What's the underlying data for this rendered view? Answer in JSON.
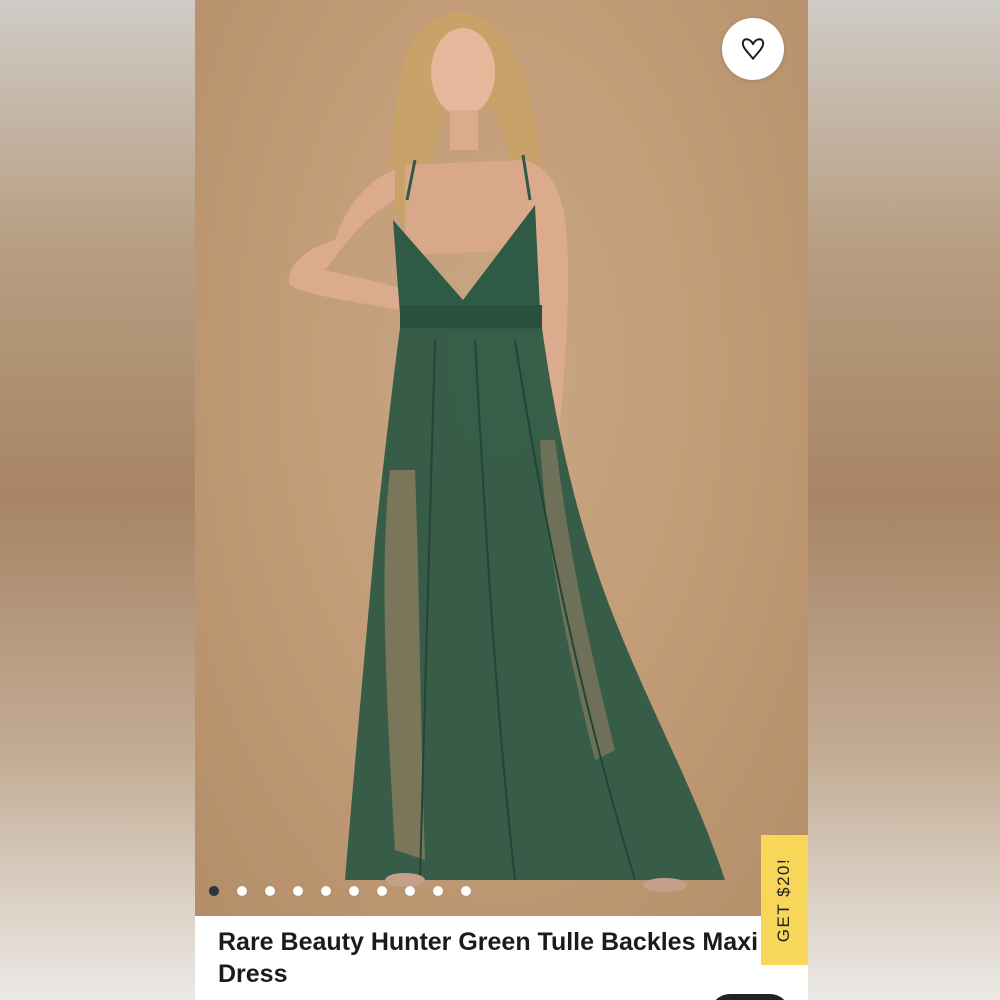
{
  "product": {
    "title": "Rare Beauty Hunter Green Tulle Backles Maxi Dress",
    "image_alt": "Model wearing a hunter green tulle backless maxi dress"
  },
  "gallery": {
    "total_images": 10,
    "active_index": 0
  },
  "wishlist": {
    "icon": "heart-outline-icon"
  },
  "promo": {
    "label": "GET $20!"
  },
  "colors": {
    "accent_yellow": "#f7d65a",
    "active_dot": "#2f3540",
    "dress_green": "#2f5a46"
  }
}
